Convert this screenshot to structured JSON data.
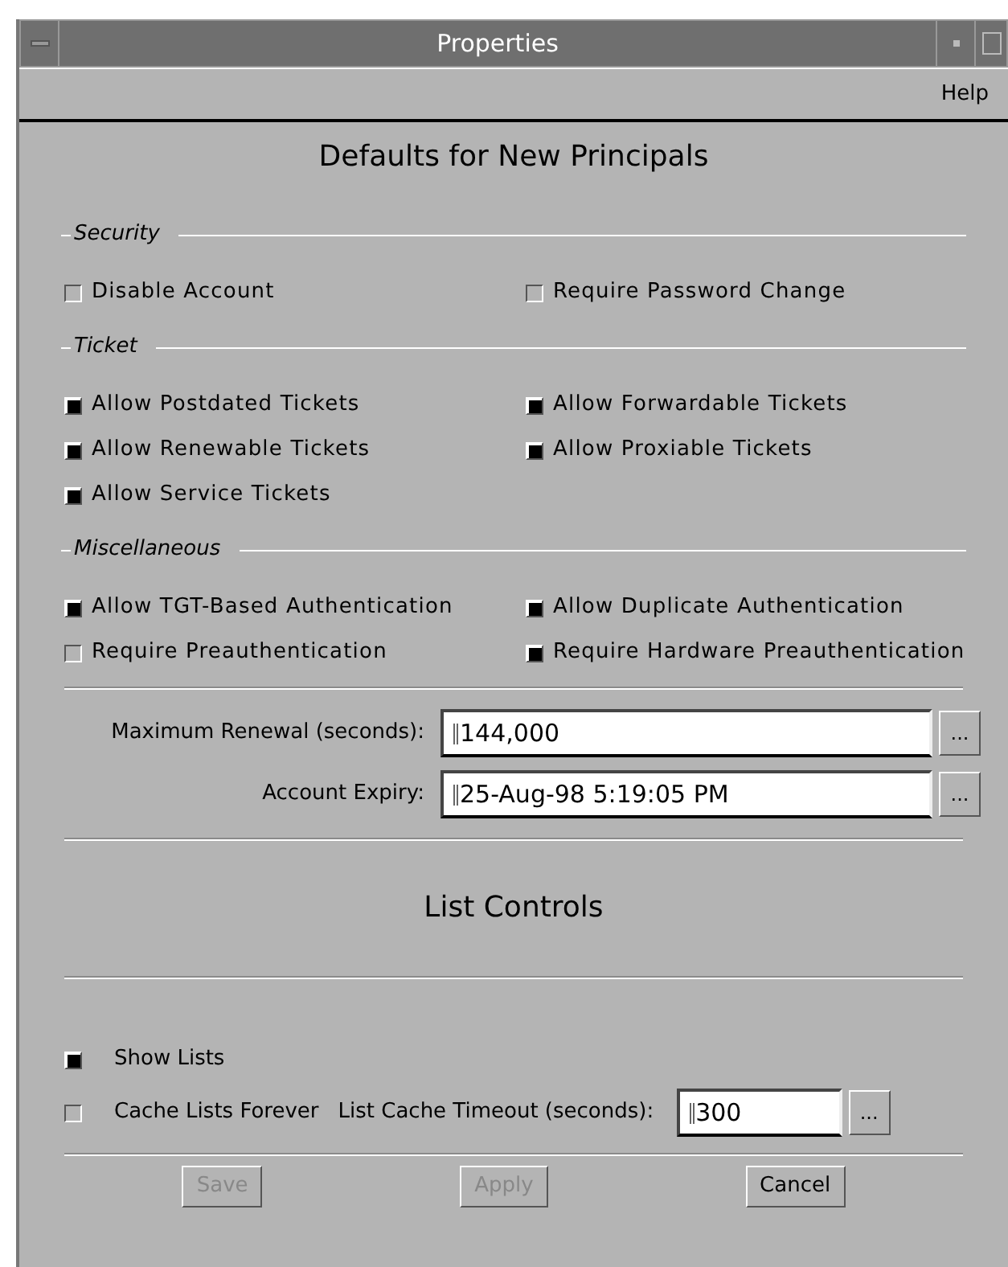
{
  "window": {
    "title": "Properties"
  },
  "menu": [
    "Help"
  ],
  "heading": "Defaults for New Principals",
  "groups": [
    {
      "title": "Security",
      "items": [
        {
          "label": "Disable Account",
          "checked": false
        },
        {
          "label": "Require Password Change",
          "checked": false
        }
      ]
    },
    {
      "title": "Ticket",
      "items": [
        {
          "label": "Allow Postdated Tickets",
          "checked": true
        },
        {
          "label": "Allow Forwardable Tickets",
          "checked": true
        },
        {
          "label": "Allow Renewable Tickets",
          "checked": true
        },
        {
          "label": "Allow Proxiable Tickets",
          "checked": true
        },
        {
          "label": "Allow Service Tickets",
          "checked": true
        }
      ]
    },
    {
      "title": "Miscellaneous",
      "items": [
        {
          "label": "Allow TGT-Based Authentication",
          "checked": true
        },
        {
          "label": "Allow Duplicate Authentication",
          "checked": true
        },
        {
          "label": "Require Preauthentication",
          "checked": false
        },
        {
          "label": "Require Hardware Preauthentication",
          "checked": true
        }
      ]
    }
  ],
  "fields": [
    {
      "label": "Maximum Renewal (seconds):",
      "value": "144,000",
      "button": "..."
    },
    {
      "label": "Account Expiry:",
      "value": "25-Aug-98 5:19:05 PM",
      "button": "..."
    }
  ],
  "list_controls": {
    "title": "List Controls",
    "show_lists": {
      "label": "Show Lists",
      "checked": true
    },
    "cache_forever": {
      "label": "Cache Lists Forever",
      "checked": false
    },
    "timeout": {
      "label": "List Cache Timeout (seconds):",
      "value": "300",
      "button": "..."
    }
  },
  "buttons": [
    {
      "label": "Save",
      "disabled": true
    },
    {
      "label": "Apply",
      "disabled": true
    },
    {
      "label": "Cancel",
      "disabled": false
    }
  ]
}
